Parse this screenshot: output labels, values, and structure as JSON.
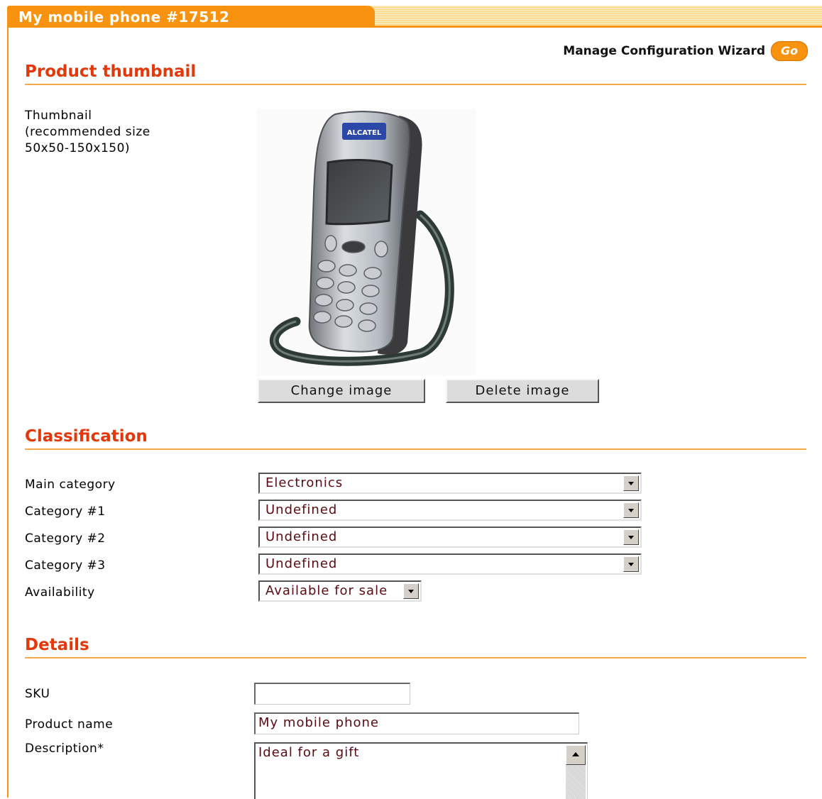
{
  "window": {
    "tab_title": "My mobile phone #17512"
  },
  "wizard": {
    "label": "Manage Configuration Wizard",
    "go_label": "Go"
  },
  "sections": {
    "thumbnail": "Product thumbnail",
    "classification": "Classification",
    "details": "Details"
  },
  "thumbnail": {
    "label_line1": "Thumbnail",
    "label_line2": "(recommended size",
    "label_line3": "50x50-150x150)",
    "brand": "ALCATEL",
    "change_label": "Change image",
    "delete_label": "Delete image"
  },
  "classification": {
    "main_category_label": "Main category",
    "main_category_value": "Electronics",
    "category1_label": "Category #1",
    "category1_value": "Undefined",
    "category2_label": "Category #2",
    "category2_value": "Undefined",
    "category3_label": "Category #3",
    "category3_value": "Undefined",
    "availability_label": "Availability",
    "availability_value": "Available for sale"
  },
  "details": {
    "sku_label": "SKU",
    "sku_value": "",
    "product_name_label": "Product name",
    "product_name_value": "My mobile phone",
    "description_label": "Description*",
    "description_value": "Ideal for a gift"
  },
  "colors": {
    "accent": "#f7930e",
    "section_title": "#e2380a",
    "field_text": "#5a0a12"
  }
}
